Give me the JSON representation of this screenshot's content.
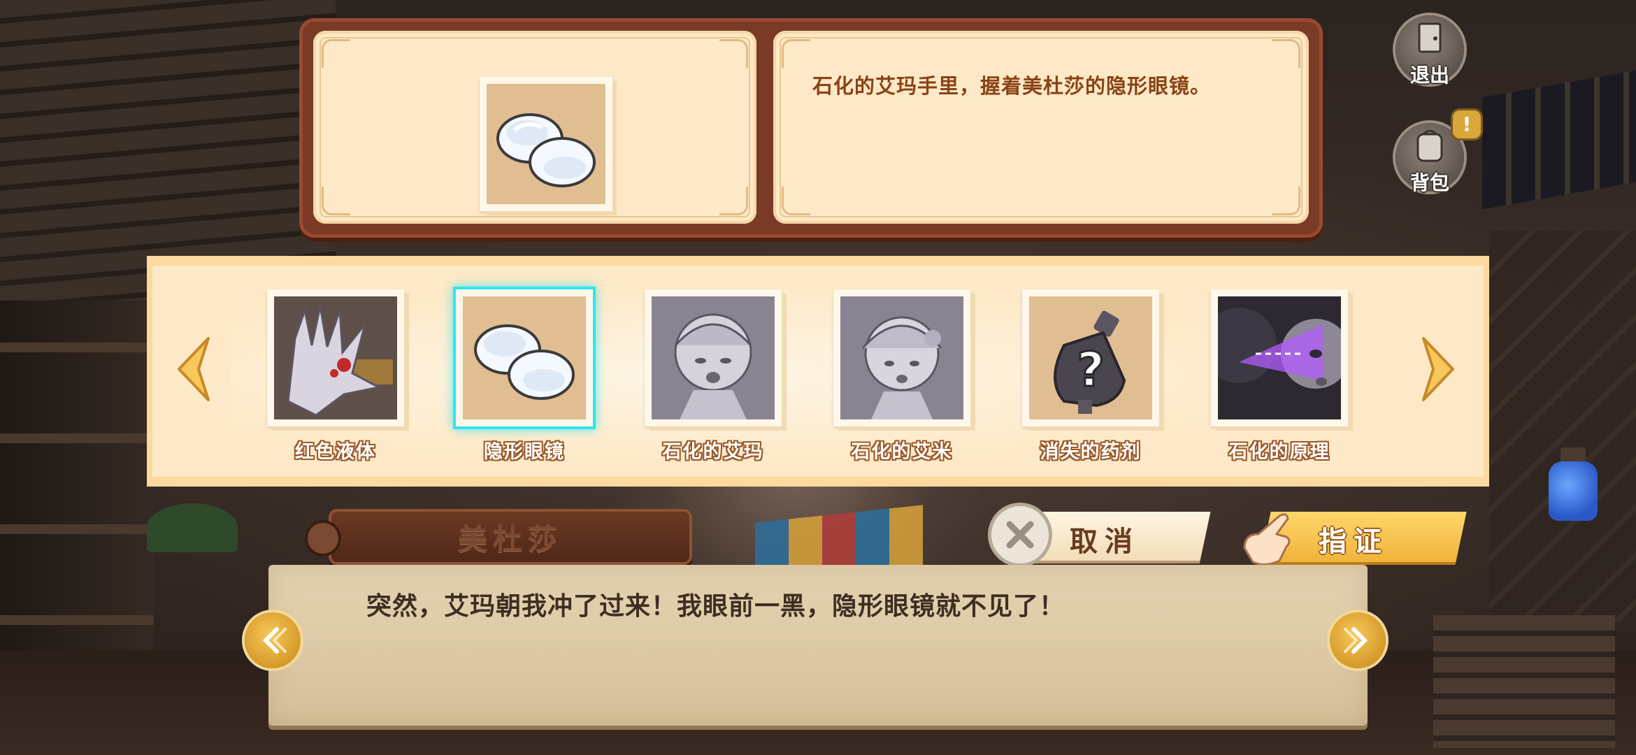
{
  "top_buttons": {
    "exit_label": "退出",
    "bag_label": "背包",
    "bag_badge": "!"
  },
  "detail": {
    "description": "石化的艾玛手里，握着美杜莎的隐形眼镜。"
  },
  "evidence": {
    "items": [
      {
        "label": "红色液体",
        "icon": "red-liquid-hand"
      },
      {
        "label": "隐形眼镜",
        "icon": "contact-lenses",
        "selected": true
      },
      {
        "label": "石化的艾玛",
        "icon": "petrified-emma"
      },
      {
        "label": "石化的艾米",
        "icon": "petrified-amy"
      },
      {
        "label": "消失的药剂",
        "icon": "mystery-potion"
      },
      {
        "label": "石化的原理",
        "icon": "petrify-gaze"
      }
    ]
  },
  "actions": {
    "cancel_label": "取消",
    "confirm_label": "指证"
  },
  "dialogue": {
    "speaker": "美杜莎",
    "text": "突然，艾玛朝我冲了过来！我眼前一黑，隐形眼镜就不见了！"
  },
  "colors": {
    "selection_glow": "#2fe6ef",
    "panel_frame": "#7a3a25",
    "card_bg": "#fde9c7",
    "description_text": "#8a4317",
    "confirm_gold": "#f1b33b"
  }
}
